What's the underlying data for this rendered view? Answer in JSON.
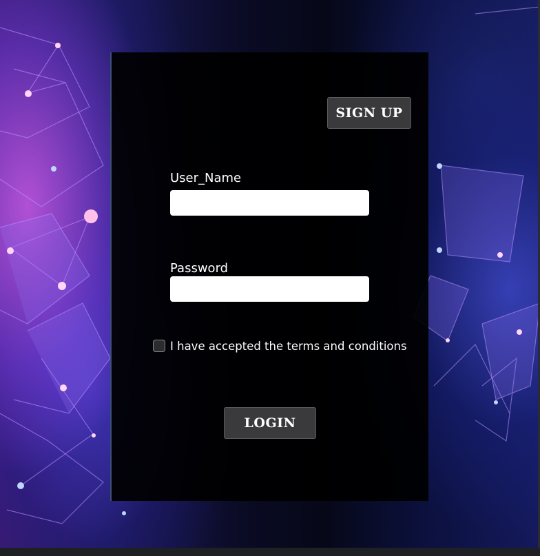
{
  "form": {
    "signup_label": "SIGN UP",
    "username_label": "User_Name",
    "username_value": "",
    "password_label": "Password",
    "password_value": "",
    "terms_checked": false,
    "terms_label": "I have accepted the terms and conditions",
    "login_label": "LOGIN"
  },
  "colors": {
    "panel_background": "#000000",
    "button_background": "#3a3a3c",
    "field_background": "#ffffff",
    "text": "#ffffff"
  }
}
